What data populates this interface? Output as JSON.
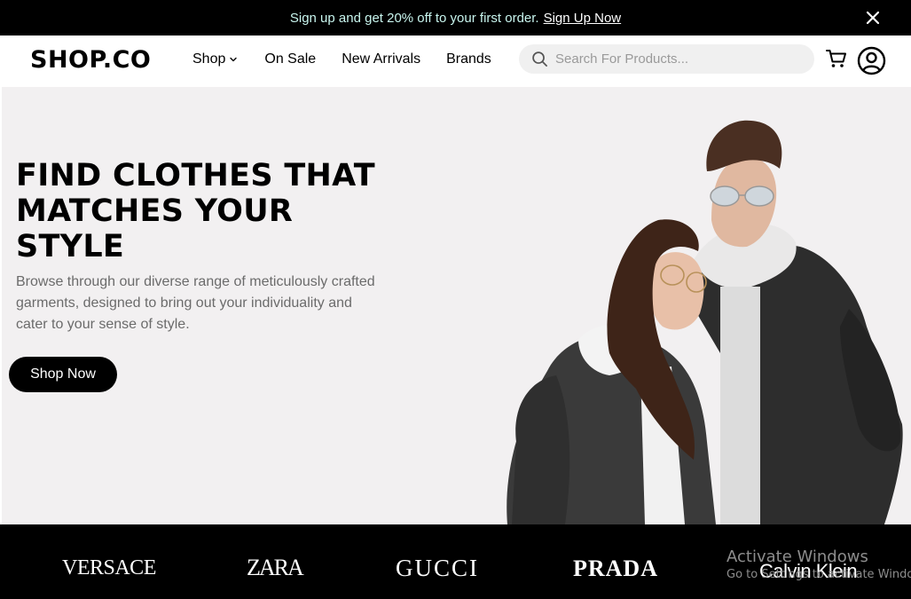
{
  "promo": {
    "message": "Sign up and get 20% off to your first order.",
    "link_label": "Sign Up Now"
  },
  "header": {
    "logo": "SHOP.CO",
    "nav": {
      "shop": "Shop",
      "on_sale": "On Sale",
      "new_arrivals": "New Arrivals",
      "brands": "Brands"
    },
    "search": {
      "placeholder": "Search For Products..."
    }
  },
  "hero": {
    "title_line1": "FIND CLOTHES THAT",
    "title_line2": "MATCHES YOUR",
    "title_line3": "STYLE",
    "description_line1": "Browse through our diverse range of meticulously crafted",
    "description_line2": "garments, designed to bring out your individuality and",
    "description_line3": "cater to your sense of style.",
    "cta_label": "Shop Now"
  },
  "brands": {
    "items": [
      "VERSACE",
      "ZARA",
      "GUCCI",
      "PRADA",
      "Calvin Klein"
    ]
  },
  "watermark": {
    "line1": "Activate Windows",
    "line2": "Go to Settings to activate Windows."
  },
  "colors": {
    "promo_bg": "#000000",
    "hero_bg": "#f2f0f1",
    "button_bg": "#000000",
    "search_bg": "#f0f0f0",
    "brand_strip_bg": "#000000"
  }
}
